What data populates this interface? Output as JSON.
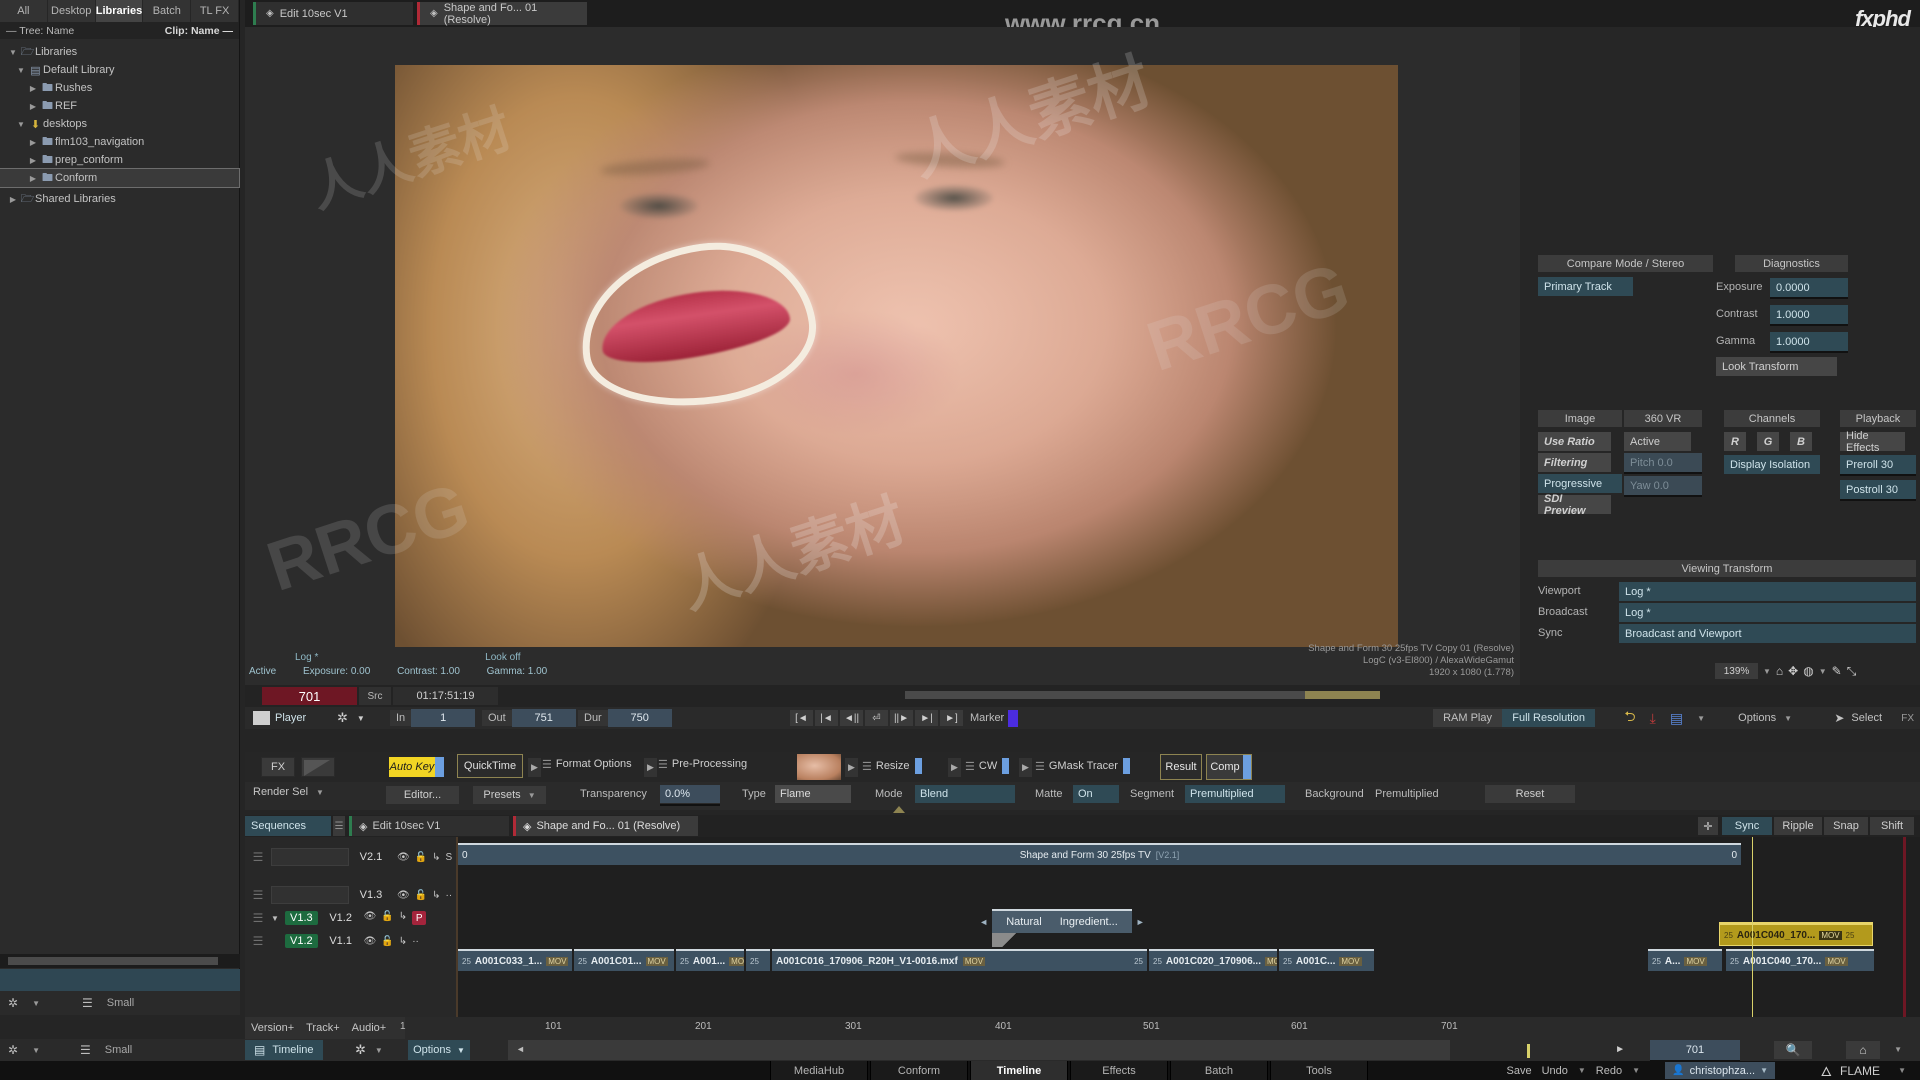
{
  "library": {
    "tabs": [
      {
        "label": "All",
        "active": false
      },
      {
        "label": "Desktop",
        "active": false
      },
      {
        "label": "Libraries",
        "active": true
      },
      {
        "label": "Batch",
        "active": false
      },
      {
        "label": "TL FX",
        "active": false
      }
    ],
    "tree_header_left": "— Tree: Name",
    "tree_header_right": "Clip: Name —",
    "tree": [
      {
        "label": "Libraries",
        "icon": "folder-open-icon",
        "depth": 0,
        "expanded": true,
        "selected": false
      },
      {
        "label": "Default Library",
        "icon": "library-icon",
        "depth": 1,
        "expanded": true,
        "selected": false
      },
      {
        "label": "Rushes",
        "icon": "folder-icon",
        "depth": 2,
        "expanded": false,
        "selected": false
      },
      {
        "label": "REF",
        "icon": "folder-icon",
        "depth": 2,
        "expanded": false,
        "selected": false
      },
      {
        "label": "desktops",
        "icon": "desktop-icon",
        "depth": 1,
        "expanded": true,
        "selected": false
      },
      {
        "label": "flm103_navigation",
        "icon": "desk-folder-icon",
        "depth": 2,
        "expanded": false,
        "selected": false
      },
      {
        "label": "prep_conform",
        "icon": "desk-folder-icon",
        "depth": 2,
        "expanded": false,
        "selected": false
      },
      {
        "label": "Conform",
        "icon": "desk-folder-icon",
        "depth": 2,
        "expanded": false,
        "selected": true
      },
      {
        "label": "Shared Libraries",
        "icon": "folder-open-icon",
        "depth": 0,
        "expanded": false,
        "selected": false
      }
    ]
  },
  "viewer_tabs": [
    {
      "label": "Edit 10sec V1",
      "accent": "#2e7d4f",
      "active": false
    },
    {
      "label": "Shape and Fo... 01 (Resolve)",
      "accent": "#b02a37",
      "active": true
    }
  ],
  "viewer_overlay": {
    "active": "Active",
    "log": "Log *",
    "look": "Look off",
    "exposure": "Exposure: 0.00",
    "contrast": "Contrast: 1.00",
    "gamma": "Gamma: 1.00",
    "info_line1": "Shape and Form 30 25fps TV Copy 01 (Resolve)",
    "info_line2": "LogC (v3-EI800) / AlexaWideGamut",
    "info_line3": "1920 x 1080 (1.778)"
  },
  "watermarks": {
    "url": "www.rrcg.cn",
    "brand": "fxphd",
    "cn": "人人素材",
    "rrcg": "RRCG"
  },
  "right_panel": {
    "compare_header": "Compare Mode / Stereo",
    "primary_track": "Primary Track",
    "diagnostics_header": "Diagnostics",
    "diagnostics": [
      {
        "label": "Exposure",
        "value": "0.0000"
      },
      {
        "label": "Contrast",
        "value": "1.0000"
      },
      {
        "label": "Gamma",
        "value": "1.0000"
      }
    ],
    "look_transform": "Look Transform",
    "image_header": "Image",
    "vr_header": "360 VR",
    "channels_header": "Channels",
    "playback_header": "Playback",
    "image_items": [
      {
        "label": "Use Ratio",
        "style": "grey"
      },
      {
        "label": "Filtering",
        "style": "grey"
      },
      {
        "label": "Progressive",
        "style": "teal"
      },
      {
        "label": "SDI Preview",
        "style": "grey"
      }
    ],
    "vr_items": [
      {
        "label": "Active",
        "style": "grey"
      },
      {
        "label": "Pitch 0.0",
        "style": "dim"
      },
      {
        "label": "Yaw 0.0",
        "style": "dim"
      }
    ],
    "channels": [
      "R",
      "G",
      "B"
    ],
    "display_isolation": "Display Isolation",
    "playback_items": [
      "Hide Effects",
      "Preroll 30",
      "Postroll 30"
    ],
    "viewing_header": "Viewing Transform",
    "viewing_rows": [
      {
        "label": "Viewport",
        "value": "Log *"
      },
      {
        "label": "Broadcast",
        "value": "Log *"
      },
      {
        "label": "Sync",
        "value": "Broadcast and Viewport"
      }
    ],
    "zoom_level": "139%"
  },
  "player": {
    "timecode_frames": "701",
    "src_label": "Src",
    "src_timecode": "01:17:51:19",
    "player_label": "Player",
    "in_label": "In",
    "in_value": "1",
    "out_label": "Out",
    "out_value": "751",
    "dur_label": "Dur",
    "dur_value": "750",
    "transport_icons": [
      "[◄",
      "|◄",
      "◄||",
      "⏎",
      "||►",
      "►|",
      "►]"
    ],
    "marker_label": "Marker",
    "ram_play": "RAM Play",
    "full_resolution": "Full Resolution",
    "options_label": "Options",
    "select_label": "Select",
    "fx_corner": "FX"
  },
  "fx_bar": {
    "fx_label": "FX",
    "render_sel": "Render Sel",
    "auto_key": "Auto Key",
    "quicktime": "QuickTime",
    "nodes": [
      "Format Options",
      "Pre-Processing",
      "Resize",
      "CW",
      "GMask Tracer"
    ],
    "result": "Result",
    "comp": "Comp",
    "editor": "Editor...",
    "presets": "Presets",
    "transparency_label": "Transparency",
    "transparency_value": "0.0%",
    "type_label": "Type",
    "type_value": "Flame",
    "mode_label": "Mode",
    "mode_value": "Blend",
    "matte_label": "Matte",
    "matte_value": "On",
    "segment_label": "Segment",
    "segment_value": "Premultiplied",
    "background_label": "Background",
    "background_value": "Premultiplied",
    "reset": "Reset"
  },
  "timeline": {
    "sequences_label": "Sequences",
    "tabs": [
      {
        "label": "Edit 10sec V1",
        "accent": "#2e7d4f",
        "active": false
      },
      {
        "label": "Shape and Fo... 01 (Resolve)",
        "accent": "#b02a37",
        "active": true
      }
    ],
    "right_buttons": [
      "Sync",
      "Ripple",
      "Snap",
      "Shift"
    ],
    "tracks": [
      {
        "name": "V2.1",
        "badge": "",
        "solo": "S",
        "expand": false
      },
      {
        "name": "V1.3",
        "badge": "",
        "solo": "··",
        "expand": false
      },
      {
        "name": "V1.2",
        "badge": "V1.3",
        "solo": "P",
        "expand": true
      },
      {
        "name": "V1.1",
        "badge": "V1.2",
        "solo": "··",
        "expand": false
      }
    ],
    "v2_strip_label": "Shape and Form 30 25fps TV",
    "v2_strip_left": "0",
    "v2_strip_right": "0",
    "v2_strip_tag": "[V2.1]",
    "bfx_clip": {
      "left": "Natural",
      "right": "Ingredient..."
    },
    "clips": [
      {
        "name": "A001C033_1...",
        "fps": "25",
        "fmt": "MOV",
        "selected": false
      },
      {
        "name": "A001C01...",
        "fps": "25",
        "fmt": "MOV",
        "selected": false
      },
      {
        "name": "A001...",
        "fps": "25",
        "fmt": "MOV",
        "selected": false
      },
      {
        "name": "",
        "fps": "25",
        "fmt": "",
        "selected": false
      },
      {
        "name": "A001C016_170906_R20H_V1-0016.mxf",
        "fps": "",
        "fmt": "MOV",
        "selected": false
      },
      {
        "name": "A001C020_170906...",
        "fps": "25",
        "fmt": "MOV",
        "selected": false
      },
      {
        "name": "A001C...",
        "fps": "25",
        "fmt": "MOV",
        "selected": false
      },
      {
        "name": "A...",
        "fps": "25",
        "fmt": "MOV",
        "selected": false
      },
      {
        "name": "A001C040_170...",
        "fps": "25",
        "fmt": "MOV",
        "selected": false
      }
    ],
    "selected_clip": {
      "name": "A001C040_170...",
      "fps": "25",
      "fmt": "MOV"
    },
    "version_buttons": [
      "Version+",
      "Track+",
      "Audio+"
    ],
    "ruler_ticks": [
      "1",
      "101",
      "201",
      "301",
      "401",
      "501",
      "601",
      "701"
    ]
  },
  "bottom": {
    "timeline_label": "Timeline",
    "options_label": "Options",
    "size_label": "Small",
    "current_frame": "701",
    "search_icon": "search-icon",
    "home_icon": "home-icon"
  },
  "mode_tabs": [
    {
      "label": "MediaHub",
      "active": false
    },
    {
      "label": "Conform",
      "active": false
    },
    {
      "label": "Timeline",
      "active": true
    },
    {
      "label": "Effects",
      "active": false
    },
    {
      "label": "Batch",
      "active": false
    },
    {
      "label": "Tools",
      "active": false
    }
  ],
  "status": {
    "save": "Save",
    "undo": "Undo",
    "redo": "Redo",
    "user": "christophza...",
    "app": "FLAME"
  }
}
